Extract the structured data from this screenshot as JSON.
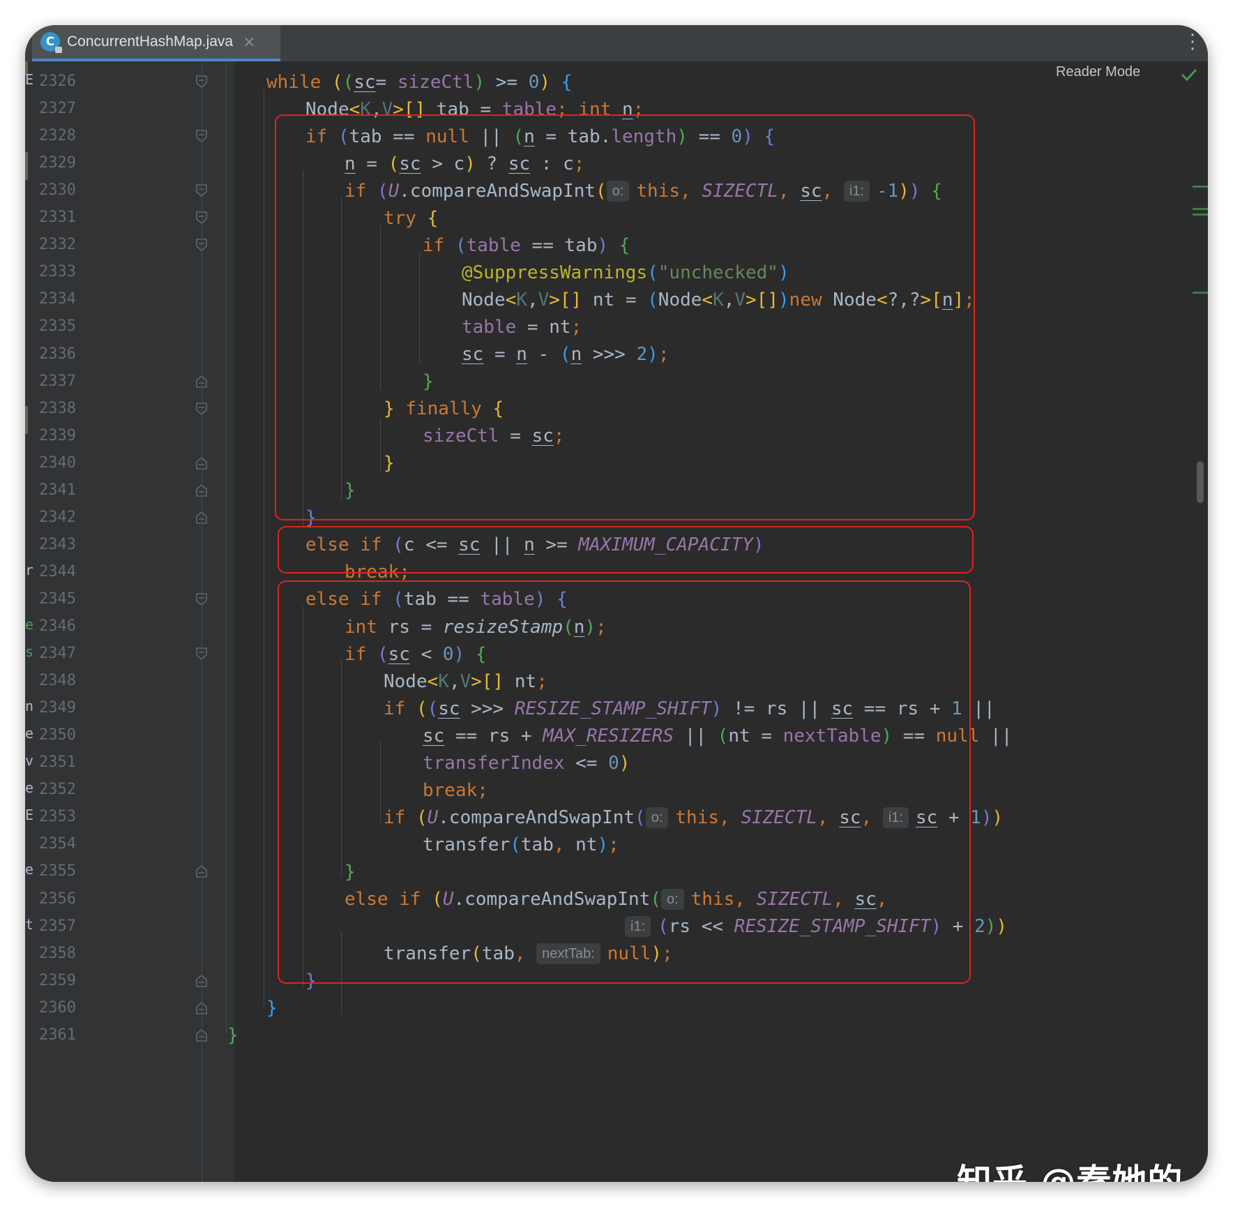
{
  "tab": {
    "filename": "ConcurrentHashMap.java",
    "icon": "java-class-icon",
    "close": "×"
  },
  "toolbar": {
    "reader_mode": "Reader Mode",
    "status_icon": "check-icon",
    "menu_icon": "more-vertical-icon"
  },
  "watermark": "知乎 @秦她的菜",
  "gutter_clip_chars": [
    "E",
    "r",
    "e",
    "s",
    "n",
    "e",
    "v",
    "e",
    "E",
    "e",
    "t"
  ],
  "line_numbers": [
    "2326",
    "2327",
    "2328",
    "2329",
    "2330",
    "2331",
    "2332",
    "2333",
    "2334",
    "2335",
    "2336",
    "2337",
    "2338",
    "2339",
    "2340",
    "2341",
    "2342",
    "2343",
    "2344",
    "2345",
    "2346",
    "2347",
    "2348",
    "2349",
    "2350",
    "2351",
    "2352",
    "2353",
    "2354",
    "2355",
    "2356",
    "2357",
    "2358",
    "2359",
    "2360",
    "2361"
  ],
  "code_lines": [
    [
      [
        "kw",
        "while "
      ],
      [
        "p1",
        "("
      ],
      [
        "p2",
        "("
      ],
      [
        "ul",
        "sc"
      ],
      [
        "",
        "= "
      ],
      [
        "fld",
        "sizeCtl"
      ],
      [
        "p2",
        ")"
      ],
      [
        "",
        " >= "
      ],
      [
        "num",
        "0"
      ],
      [
        "p1",
        ")"
      ],
      [
        "",
        " "
      ],
      [
        "p3",
        "{"
      ]
    ],
    [
      [
        "",
        "Node"
      ],
      [
        "p1",
        "<"
      ],
      [
        "tp",
        "K"
      ],
      [
        "",
        ","
      ],
      [
        "tp",
        "V"
      ],
      [
        "p1",
        ">[]"
      ],
      [
        "",
        " tab = "
      ],
      [
        "fld",
        "table"
      ],
      [
        "kw",
        "; int "
      ],
      [
        "ul",
        "n"
      ],
      [
        "kw",
        ";"
      ]
    ],
    [
      [
        "kw",
        "if "
      ],
      [
        "p4",
        "("
      ],
      [
        "",
        "tab == "
      ],
      [
        "kw",
        "null"
      ],
      [
        "",
        " || "
      ],
      [
        "p2",
        "("
      ],
      [
        "ul",
        "n"
      ],
      [
        "",
        " = tab."
      ],
      [
        "fld",
        "length"
      ],
      [
        "p2",
        ")"
      ],
      [
        "",
        " == "
      ],
      [
        "num",
        "0"
      ],
      [
        "p4",
        ")"
      ],
      [
        "",
        " "
      ],
      [
        "p4",
        "{"
      ]
    ],
    [
      [
        "ul",
        "n"
      ],
      [
        "",
        " = "
      ],
      [
        "p1",
        "("
      ],
      [
        "ul",
        "sc"
      ],
      [
        "",
        " > c"
      ],
      [
        "p1",
        ")"
      ],
      [
        "",
        " ? "
      ],
      [
        "ul",
        "sc"
      ],
      [
        "",
        " : c"
      ],
      [
        "kw",
        ";"
      ]
    ],
    [
      [
        "kw",
        "if "
      ],
      [
        "p4",
        "("
      ],
      [
        "cst",
        "U"
      ],
      [
        "",
        ".compareAndSwapInt"
      ],
      [
        "p1",
        "("
      ],
      [
        "hint",
        "o:"
      ],
      [
        "kw",
        "this, "
      ],
      [
        "cst",
        "SIZECTL"
      ],
      [
        "kw",
        ", "
      ],
      [
        "ul",
        "sc"
      ],
      [
        "kw",
        ", "
      ],
      [
        "hint",
        "i1:"
      ],
      [
        "num",
        "-1"
      ],
      [
        "p1",
        ")"
      ],
      [
        "p4",
        ")"
      ],
      [
        "",
        " "
      ],
      [
        "p2",
        "{"
      ]
    ],
    [
      [
        "kw",
        "try "
      ],
      [
        "p1",
        "{"
      ]
    ],
    [
      [
        "kw",
        "if "
      ],
      [
        "p4",
        "("
      ],
      [
        "fld",
        "table"
      ],
      [
        "",
        " == tab"
      ],
      [
        "p4",
        ")"
      ],
      [
        "",
        " "
      ],
      [
        "p2",
        "{"
      ]
    ],
    [
      [
        "ann",
        "@SuppressWarnings"
      ],
      [
        "p3",
        "("
      ],
      [
        "str",
        "\"unchecked\""
      ],
      [
        "p3",
        ")"
      ]
    ],
    [
      [
        "",
        "Node"
      ],
      [
        "p1",
        "<"
      ],
      [
        "tp",
        "K"
      ],
      [
        "",
        ","
      ],
      [
        "tp",
        "V"
      ],
      [
        "p1",
        ">[]"
      ],
      [
        "",
        " nt = "
      ],
      [
        "p3",
        "("
      ],
      [
        "",
        "Node"
      ],
      [
        "p1",
        "<"
      ],
      [
        "tp",
        "K"
      ],
      [
        "",
        ","
      ],
      [
        "tp",
        "V"
      ],
      [
        "p1",
        ">[]"
      ],
      [
        "p3",
        ")"
      ],
      [
        "kw",
        "new "
      ],
      [
        "",
        "Node"
      ],
      [
        "p1",
        "<"
      ],
      [
        "",
        "?,?"
      ],
      [
        "p1",
        ">["
      ],
      [
        "ul",
        "n"
      ],
      [
        "p1",
        "]"
      ],
      [
        "kw",
        ";"
      ]
    ],
    [
      [
        "fld",
        "table"
      ],
      [
        "",
        " = nt"
      ],
      [
        "kw",
        ";"
      ]
    ],
    [
      [
        "ul",
        "sc"
      ],
      [
        "",
        " = "
      ],
      [
        "ul",
        "n"
      ],
      [
        "",
        " - "
      ],
      [
        "p3",
        "("
      ],
      [
        "ul",
        "n"
      ],
      [
        "",
        " >>> "
      ],
      [
        "num",
        "2"
      ],
      [
        "p3",
        ")"
      ],
      [
        "kw",
        ";"
      ]
    ],
    [
      [
        "p2",
        "}"
      ]
    ],
    [
      [
        "p1",
        "} "
      ],
      [
        "kw",
        "finally "
      ],
      [
        "p1",
        "{"
      ]
    ],
    [
      [
        "fld",
        "sizeCtl"
      ],
      [
        "",
        " = "
      ],
      [
        "ul",
        "sc"
      ],
      [
        "kw",
        ";"
      ]
    ],
    [
      [
        "p1",
        "}"
      ]
    ],
    [
      [
        "p2",
        "}"
      ]
    ],
    [
      [
        "p4",
        "}"
      ]
    ],
    [
      [
        "kw",
        "else if "
      ],
      [
        "p4",
        "("
      ],
      [
        "",
        "c <= "
      ],
      [
        "ul",
        "sc"
      ],
      [
        "",
        " || "
      ],
      [
        "ul",
        "n"
      ],
      [
        "",
        " >= "
      ],
      [
        "cst",
        "MAXIMUM_CAPACITY"
      ],
      [
        "p4",
        ")"
      ]
    ],
    [
      [
        "kw",
        "break;"
      ]
    ],
    [
      [
        "kw",
        "else if "
      ],
      [
        "p4",
        "("
      ],
      [
        "",
        "tab == "
      ],
      [
        "fld",
        "table"
      ],
      [
        "p4",
        ")"
      ],
      [
        "",
        " "
      ],
      [
        "p4",
        "{"
      ]
    ],
    [
      [
        "kw",
        "int "
      ],
      [
        "",
        "rs = "
      ],
      [
        "ital",
        "resizeStamp"
      ],
      [
        "p2",
        "("
      ],
      [
        "ul",
        "n"
      ],
      [
        "p2",
        ")"
      ],
      [
        "kw",
        ";"
      ]
    ],
    [
      [
        "kw",
        "if "
      ],
      [
        "p4",
        "("
      ],
      [
        "ul",
        "sc"
      ],
      [
        "",
        " < "
      ],
      [
        "num",
        "0"
      ],
      [
        "p4",
        ")"
      ],
      [
        "",
        " "
      ],
      [
        "p2",
        "{"
      ]
    ],
    [
      [
        "",
        "Node"
      ],
      [
        "p1",
        "<"
      ],
      [
        "tp",
        "K"
      ],
      [
        "",
        ","
      ],
      [
        "tp",
        "V"
      ],
      [
        "p1",
        ">[]"
      ],
      [
        "",
        " nt"
      ],
      [
        "kw",
        ";"
      ]
    ],
    [
      [
        "kw",
        "if "
      ],
      [
        "p1",
        "("
      ],
      [
        "p4",
        "("
      ],
      [
        "ul",
        "sc"
      ],
      [
        "",
        " >>> "
      ],
      [
        "cst",
        "RESIZE_STAMP_SHIFT"
      ],
      [
        "p4",
        ")"
      ],
      [
        "",
        " != rs || "
      ],
      [
        "ul",
        "sc"
      ],
      [
        "",
        " == rs + "
      ],
      [
        "num",
        "1"
      ],
      [
        "",
        " ||"
      ]
    ],
    [
      [
        "ul",
        "sc"
      ],
      [
        "",
        " == rs + "
      ],
      [
        "cst",
        "MAX_RESIZERS"
      ],
      [
        "",
        " || "
      ],
      [
        "p2",
        "("
      ],
      [
        "",
        "nt = "
      ],
      [
        "fld",
        "nextTable"
      ],
      [
        "p2",
        ")"
      ],
      [
        "",
        " == "
      ],
      [
        "kw",
        "null"
      ],
      [
        "",
        " ||"
      ]
    ],
    [
      [
        "fld",
        "transferIndex"
      ],
      [
        "",
        " <= "
      ],
      [
        "num",
        "0"
      ],
      [
        "p1",
        ")"
      ]
    ],
    [
      [
        "kw",
        "break;"
      ]
    ],
    [
      [
        "kw",
        "if "
      ],
      [
        "p1",
        "("
      ],
      [
        "cst",
        "U"
      ],
      [
        "",
        ".compareAndSwapInt"
      ],
      [
        "p4",
        "("
      ],
      [
        "hint",
        "o:"
      ],
      [
        "kw",
        "this, "
      ],
      [
        "cst",
        "SIZECTL"
      ],
      [
        "kw",
        ", "
      ],
      [
        "ul",
        "sc"
      ],
      [
        "kw",
        ", "
      ],
      [
        "hint",
        "i1:"
      ],
      [
        "ul",
        "sc"
      ],
      [
        "",
        " + "
      ],
      [
        "num",
        "1"
      ],
      [
        "p4",
        ")"
      ],
      [
        "p1",
        ")"
      ]
    ],
    [
      [
        "",
        "transfer"
      ],
      [
        "p3",
        "("
      ],
      [
        "",
        "tab"
      ],
      [
        "kw",
        ", "
      ],
      [
        "",
        "nt"
      ],
      [
        "p3",
        ")"
      ],
      [
        "kw",
        ";"
      ]
    ],
    [
      [
        "p2",
        "}"
      ]
    ],
    [
      [
        "kw",
        "else if "
      ],
      [
        "p1",
        "("
      ],
      [
        "cst",
        "U"
      ],
      [
        "",
        ".compareAndSwapInt"
      ],
      [
        "p2",
        "("
      ],
      [
        "hint",
        "o:"
      ],
      [
        "kw",
        "this, "
      ],
      [
        "cst",
        "SIZECTL"
      ],
      [
        "kw",
        ", "
      ],
      [
        "ul",
        "sc"
      ],
      [
        "kw",
        ","
      ]
    ],
    [
      [
        "hint",
        "i1:"
      ],
      [
        "p4",
        "("
      ],
      [
        "",
        "rs << "
      ],
      [
        "cst",
        "RESIZE_STAMP_SHIFT"
      ],
      [
        "p4",
        ")"
      ],
      [
        "",
        " + "
      ],
      [
        "num",
        "2"
      ],
      [
        "p2",
        ")"
      ],
      [
        "p1",
        ")"
      ]
    ],
    [
      [
        "",
        "transfer"
      ],
      [
        "p1",
        "("
      ],
      [
        "",
        "tab"
      ],
      [
        "kw",
        ", "
      ],
      [
        "hint",
        "nextTab:"
      ],
      [
        "kw",
        "null"
      ],
      [
        "p1",
        ")"
      ],
      [
        "kw",
        ";"
      ]
    ],
    [
      [
        "p4",
        "}"
      ]
    ],
    [
      [
        "p3",
        "}"
      ]
    ],
    [
      [
        "p2",
        "}"
      ]
    ]
  ],
  "colors": {
    "background": "#2b2b2b",
    "gutter": "#313335",
    "keyword": "#cc7832",
    "field": "#9876aa",
    "number": "#6897bb",
    "string": "#6a8759",
    "annotation": "#bbb529",
    "highlight_box": "#e0231c"
  }
}
